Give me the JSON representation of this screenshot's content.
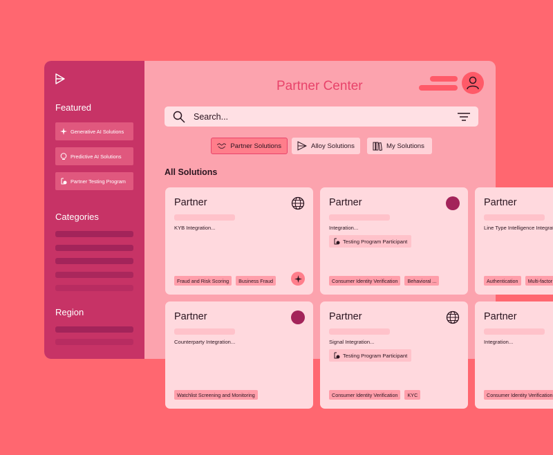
{
  "header": {
    "title": "Partner Center"
  },
  "search": {
    "placeholder": "Search..."
  },
  "sidebar": {
    "featured_heading": "Featured",
    "featured": [
      {
        "label": "Generative AI Solutions",
        "icon": "sparkle-icon"
      },
      {
        "label": "Predictive AI Solutions",
        "icon": "brain-icon"
      },
      {
        "label": "Partner Testing Program",
        "icon": "flask-check-icon"
      }
    ],
    "categories_heading": "Categories",
    "region_heading": "Region"
  },
  "tabs": [
    {
      "label": "Partner Solutions",
      "icon": "handshake-icon",
      "active": true
    },
    {
      "label": "Alloy Solutions",
      "icon": "alloy-logo-icon",
      "active": false
    },
    {
      "label": "My Solutions",
      "icon": "books-icon",
      "active": false
    }
  ],
  "section": {
    "title": "All Solutions"
  },
  "cards": [
    {
      "title": "Partner",
      "subtitle": "KYB Integration...",
      "badge": "",
      "tags": [
        "Fraud and Risk Scoring",
        "Business Fraud"
      ],
      "icon": "globe-icon"
    },
    {
      "title": "Partner",
      "subtitle": "Integration...",
      "badge": "Testing Program Participant",
      "tags": [
        "Consumer Identity Verification",
        "Behavioral ..."
      ],
      "icon": "dot"
    },
    {
      "title": "Partner",
      "subtitle": "Line Type Intelligence Integration...",
      "badge": "",
      "tags": [
        "Authentication",
        "Multi-factor"
      ],
      "icon": ""
    },
    {
      "title": "Partner",
      "subtitle": "Counterparty Integration...",
      "badge": "",
      "tags": [
        "Watchlist Screening and Monitoring"
      ],
      "icon": "dot"
    },
    {
      "title": "Partner",
      "subtitle": "Signal Integration...",
      "badge": "Testing Program Participant",
      "tags": [
        "Consumer Identity Verification",
        "KYC"
      ],
      "icon": "globe-icon"
    },
    {
      "title": "Partner",
      "subtitle": "Integration...",
      "badge": "",
      "tags": [
        "Consumer Identity Verification"
      ],
      "icon": ""
    }
  ],
  "colors": {
    "background": "#FF6770",
    "sidebar": "#C73366",
    "panel": "#FCA3AE",
    "card": "#FFD9DE",
    "accent": "#E8436A"
  }
}
